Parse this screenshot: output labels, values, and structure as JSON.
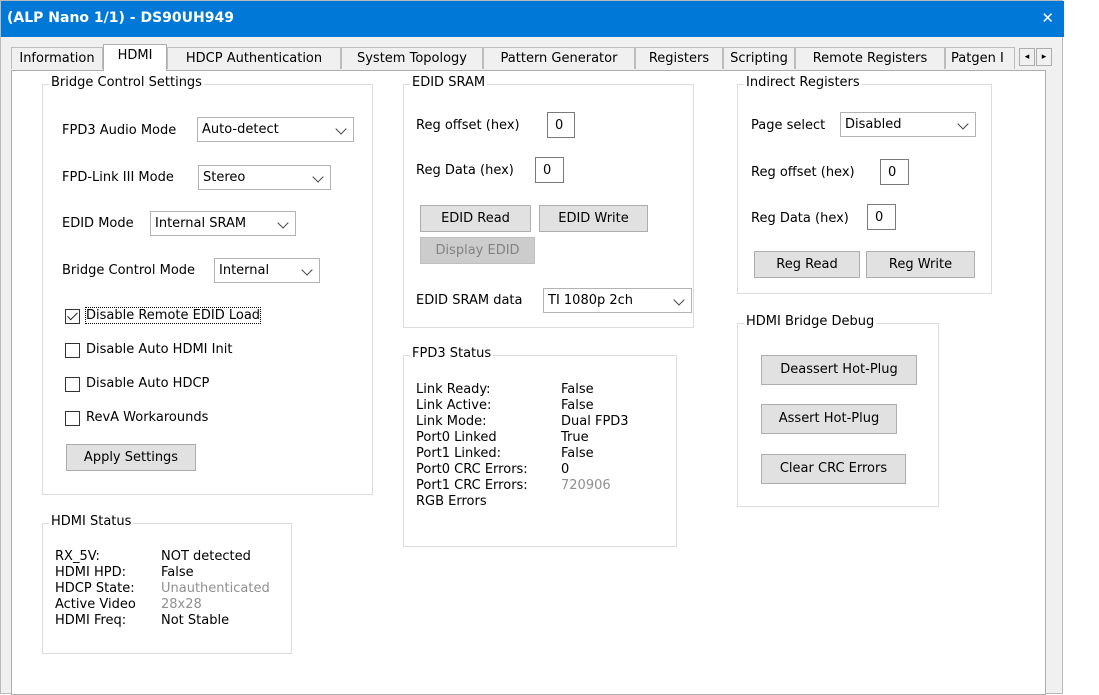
{
  "window": {
    "title": "(ALP Nano 1/1) - DS90UH949",
    "close_glyph": "✕"
  },
  "tabs": [
    "Information",
    "HDMI",
    "HDCP Authentication",
    "System Topology",
    "Pattern Generator",
    "Registers",
    "Scripting",
    "Remote Registers",
    "Patgen I"
  ],
  "active_tab": "HDMI",
  "bridge_control": {
    "legend": "Bridge Control Settings",
    "fpd3_audio_mode": {
      "label": "FPD3 Audio Mode",
      "value": "Auto-detect"
    },
    "fpd_link_mode": {
      "label": "FPD-Link III Mode",
      "value": "Stereo"
    },
    "edid_mode": {
      "label": "EDID Mode",
      "value": "Internal SRAM"
    },
    "bridge_control_mode": {
      "label": "Bridge Control Mode",
      "value": "Internal"
    },
    "checkboxes": [
      {
        "label": "Disable Remote EDID Load",
        "checked": true
      },
      {
        "label": "Disable Auto HDMI Init",
        "checked": false
      },
      {
        "label": "Disable Auto HDCP",
        "checked": false
      },
      {
        "label": "RevA Workarounds",
        "checked": false
      }
    ],
    "apply_button": "Apply Settings"
  },
  "hdmi_status": {
    "legend": "HDMI Status",
    "rows": [
      {
        "label": "RX_5V:",
        "value": "NOT detected",
        "dim": false
      },
      {
        "label": "HDMI HPD:",
        "value": "False",
        "dim": false
      },
      {
        "label": "HDCP State:",
        "value": "Unauthenticated",
        "dim": true
      },
      {
        "label": "Active Video",
        "value": "28x28",
        "dim": true
      },
      {
        "label": "HDMI Freq:",
        "value": "Not Stable",
        "dim": false
      }
    ]
  },
  "edid_sram": {
    "legend": "EDID SRAM",
    "reg_offset": {
      "label": "Reg offset (hex)",
      "value": "0"
    },
    "reg_data": {
      "label": "Reg Data (hex)",
      "value": "0"
    },
    "read_button": "EDID Read",
    "write_button": "EDID Write",
    "display_button": "Display EDID",
    "sram_data": {
      "label": "EDID SRAM data",
      "value": "TI 1080p 2ch"
    }
  },
  "fpd3_status": {
    "legend": "FPD3 Status",
    "rows": [
      {
        "label": "Link Ready:",
        "value": "False",
        "dim": false
      },
      {
        "label": "Link Active:",
        "value": "False",
        "dim": false
      },
      {
        "label": "Link Mode:",
        "value": "Dual FPD3",
        "dim": false
      },
      {
        "label": "Port0 Linked",
        "value": "True",
        "dim": false
      },
      {
        "label": "Port1 Linked:",
        "value": "False",
        "dim": false
      },
      {
        "label": "Port0 CRC Errors:",
        "value": "0",
        "dim": false
      },
      {
        "label": "Port1 CRC Errors:",
        "value": "720906",
        "dim": true
      },
      {
        "label": "RGB Errors",
        "value": "",
        "dim": false
      }
    ]
  },
  "indirect_registers": {
    "legend": "Indirect Registers",
    "page_select": {
      "label": "Page select",
      "value": "Disabled"
    },
    "reg_offset": {
      "label": "Reg offset (hex)",
      "value": "0"
    },
    "reg_data": {
      "label": "Reg Data (hex)",
      "value": "0"
    },
    "read_button": "Reg Read",
    "write_button": "Reg Write"
  },
  "hdmi_bridge_debug": {
    "legend": "HDMI Bridge Debug",
    "deassert_button": "Deassert Hot-Plug",
    "assert_button": "Assert Hot-Plug",
    "clear_button": "Clear CRC Errors"
  }
}
